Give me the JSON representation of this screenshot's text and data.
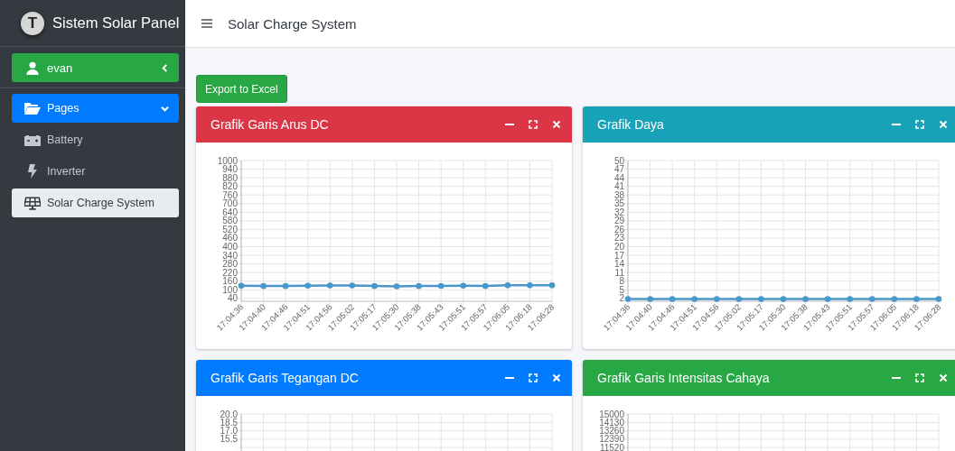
{
  "sidebar": {
    "brand": {
      "logo_letter": "T",
      "title": "Sistem Solar Panel"
    },
    "user": {
      "name": "evan",
      "expanded": false
    },
    "nav": {
      "label": "Pages",
      "expanded": true,
      "children": [
        {
          "label": "Battery",
          "kind": "battery",
          "selected": false
        },
        {
          "label": "Inverter",
          "kind": "bolt",
          "selected": false
        },
        {
          "label": "Solar Charge System",
          "kind": "solar",
          "selected": true
        }
      ]
    }
  },
  "navbar": {
    "title": "Solar Charge System"
  },
  "export_button": "Export to Excel",
  "cards": [
    {
      "title": "Grafik Garis Arus DC",
      "color": "#dc3545",
      "chart_data": {
        "type": "line",
        "grid": true,
        "categories": [
          "17:04:36",
          "17:04:40",
          "17:04:46",
          "17:04:51",
          "17:04:56",
          "17:05:02",
          "17:05:17",
          "17:05:30",
          "17:05:38",
          "17:05:43",
          "17:05:51",
          "17:05:57",
          "17:06:05",
          "17:06:18",
          "17:06:28"
        ],
        "ylim": [
          20,
          1000
        ],
        "yticks": [
          40,
          100,
          160,
          220,
          280,
          340,
          400,
          460,
          520,
          580,
          640,
          700,
          760,
          820,
          880,
          940,
          1000
        ],
        "series": [
          {
            "color": "#4a97c9",
            "marker": true,
            "values": [
              128,
              126,
              126,
              128,
              130,
              130,
              126,
              124,
              126,
              127,
              128,
              126,
              131,
              131,
              131
            ]
          }
        ]
      }
    },
    {
      "title": "Grafik Daya",
      "color": "#17a2b8",
      "chart_data": {
        "type": "line",
        "grid": true,
        "categories": [
          "17:04:36",
          "17:04:40",
          "17:04:46",
          "17:04:51",
          "17:04:56",
          "17:05:02",
          "17:05:17",
          "17:05:30",
          "17:05:38",
          "17:05:43",
          "17:05:51",
          "17:05:57",
          "17:06:05",
          "17:06:18",
          "17:06:28"
        ],
        "ylim": [
          1,
          50
        ],
        "yticks": [
          2,
          5,
          8,
          11,
          14,
          17,
          20,
          23,
          26,
          29,
          32,
          35,
          38,
          41,
          44,
          47,
          50
        ],
        "series": [
          {
            "color": "#4a97c9",
            "marker": true,
            "values": [
              1.8,
              1.8,
              1.8,
              1.8,
              1.8,
              1.8,
              1.8,
              1.8,
              1.8,
              1.8,
              1.8,
              1.8,
              1.8,
              1.8,
              1.8
            ]
          }
        ]
      }
    },
    {
      "title": "Grafik Garis Tegangan DC",
      "color": "#007bff",
      "axis_labels": [
        "20.0",
        "18.5",
        "17.0",
        "15.5"
      ]
    },
    {
      "title": "Grafik Garis Intensitas Cahaya",
      "color": "#28a745",
      "axis_labels": [
        "15000",
        "14130",
        "13260",
        "12390",
        "11520"
      ]
    }
  ]
}
